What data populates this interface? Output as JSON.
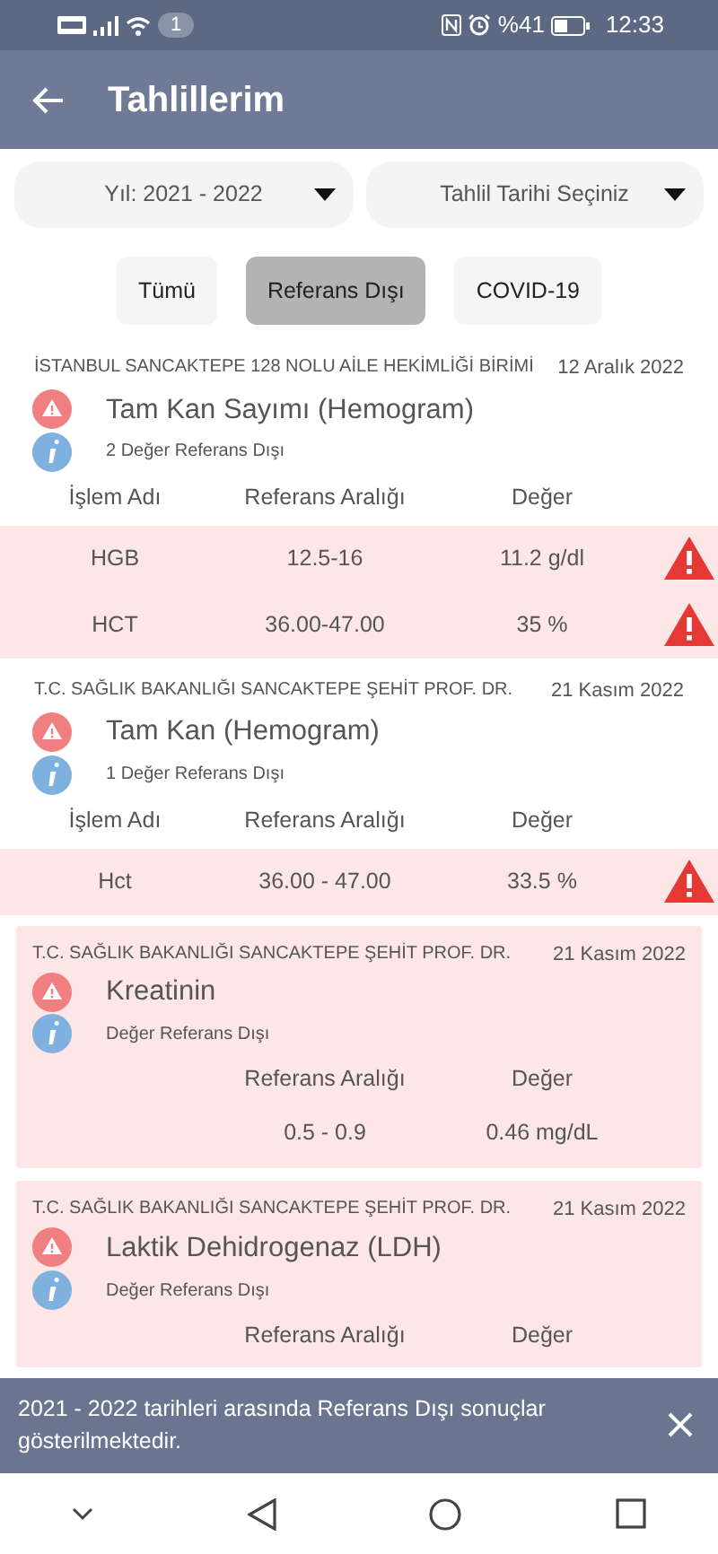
{
  "status_bar": {
    "notification_count": "1",
    "battery": "%41",
    "time": "12:33"
  },
  "app_bar": {
    "title": "Tahlillerim"
  },
  "dropdowns": [
    {
      "label": "Yıl: 2021 - 2022"
    },
    {
      "label": "Tahlil Tarihi Seçiniz"
    }
  ],
  "tabs": [
    {
      "label": "Tümü",
      "selected": false
    },
    {
      "label": "Referans Dışı",
      "selected": true
    },
    {
      "label": "COVID-19",
      "selected": false
    }
  ],
  "results": [
    {
      "kind": "plain",
      "institution": "İSTANBUL SANCAKTEPE 128 NOLU AİLE HEKİMLİĞİ BİRİMİ",
      "date": "12 Aralık 2022",
      "test": "Tam Kan Sayımı (Hemogram)",
      "summary": "2 Değer Referans Dışı",
      "columns": [
        "İşlem Adı",
        "Referans Aralığı",
        "Değer"
      ],
      "rows": [
        {
          "name": "HGB",
          "range": "12.5-16",
          "value": "11.2 g/dl",
          "warning": true
        },
        {
          "name": "HCT",
          "range": "36.00-47.00",
          "value": "35 %",
          "warning": true
        }
      ]
    },
    {
      "kind": "plain",
      "institution": "T.C. SAĞLIK BAKANLIĞI SANCAKTEPE ŞEHİT PROF. DR.",
      "date": "21 Kasım 2022",
      "test": "Tam Kan (Hemogram)",
      "summary": "1 Değer Referans Dışı",
      "columns": [
        "İşlem Adı",
        "Referans Aralığı",
        "Değer"
      ],
      "rows": [
        {
          "name": "Hct",
          "range": "36.00 - 47.00",
          "value": "33.5 %",
          "warning": true
        }
      ]
    },
    {
      "kind": "boxed",
      "institution": "T.C. SAĞLIK BAKANLIĞI SANCAKTEPE ŞEHİT PROF. DR.",
      "date": "21 Kasım 2022",
      "test": "Kreatinin",
      "summary": "Değer Referans Dışı",
      "columns": [
        "Referans Aralığı",
        "Değer"
      ],
      "rows": [
        {
          "range": "0.5 - 0.9",
          "value": "0.46 mg/dL",
          "warning": false
        }
      ]
    },
    {
      "kind": "boxed",
      "institution": "T.C. SAĞLIK BAKANLIĞI SANCAKTEPE ŞEHİT PROF. DR.",
      "date": "21 Kasım 2022",
      "test": "Laktik Dehidrogenaz (LDH)",
      "summary": "Değer Referans Dışı",
      "columns": [
        "Referans Aralığı",
        "Değer"
      ]
    }
  ],
  "snackbar": {
    "message": "2021 - 2022 tarihleri arasında Referans Dışı sonuçlar gösterilmektedir."
  }
}
